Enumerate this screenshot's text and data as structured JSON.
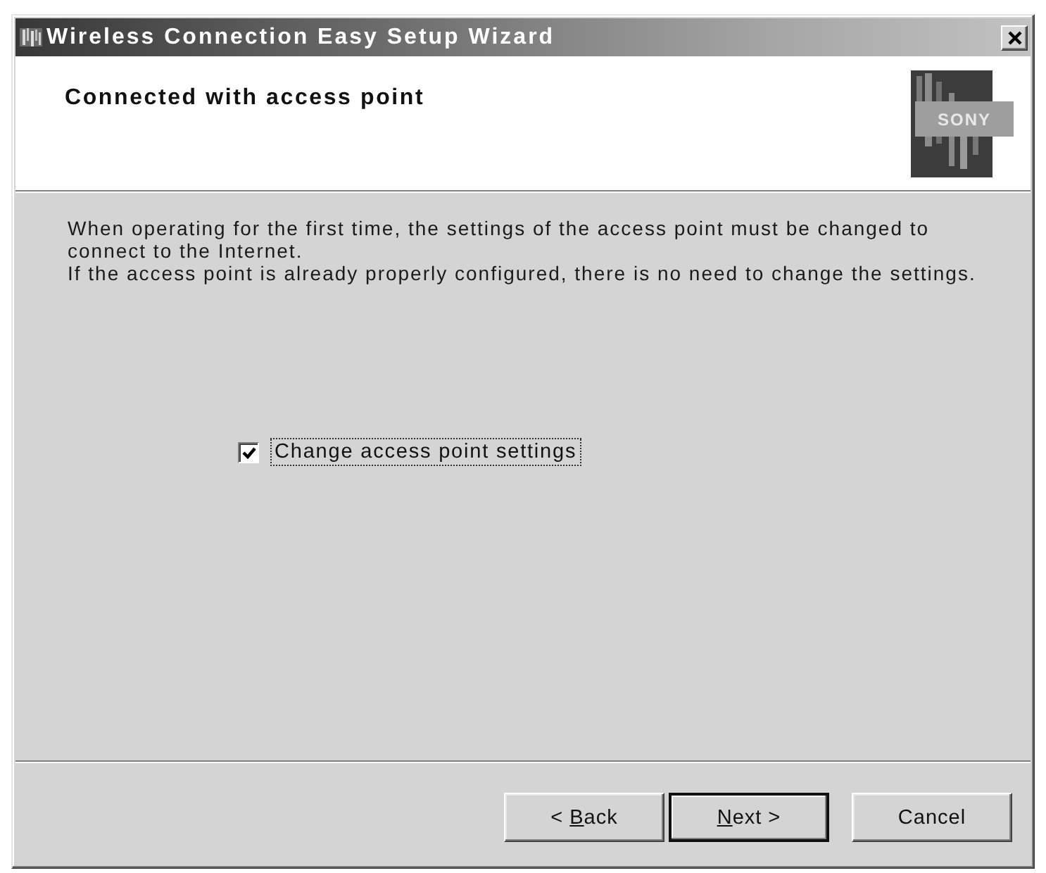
{
  "window": {
    "title": "Wireless Connection Easy Setup Wizard"
  },
  "header": {
    "title": "Connected with access point",
    "logo_text": "SONY"
  },
  "body": {
    "paragraphs": [
      "When operating for the first time, the settings of the access point must be changed to connect to the Internet.",
      "If the access point is already properly configured, there is no need to change the settings."
    ]
  },
  "options": [
    {
      "label": "Change access point settings",
      "checked": true,
      "focused": true
    }
  ],
  "buttons": [
    {
      "label": "< Back",
      "mnemonic": true,
      "default": false
    },
    {
      "label": "Next >",
      "mnemonic": true,
      "default": true
    },
    {
      "label": "Cancel",
      "mnemonic": false,
      "default": false
    }
  ]
}
